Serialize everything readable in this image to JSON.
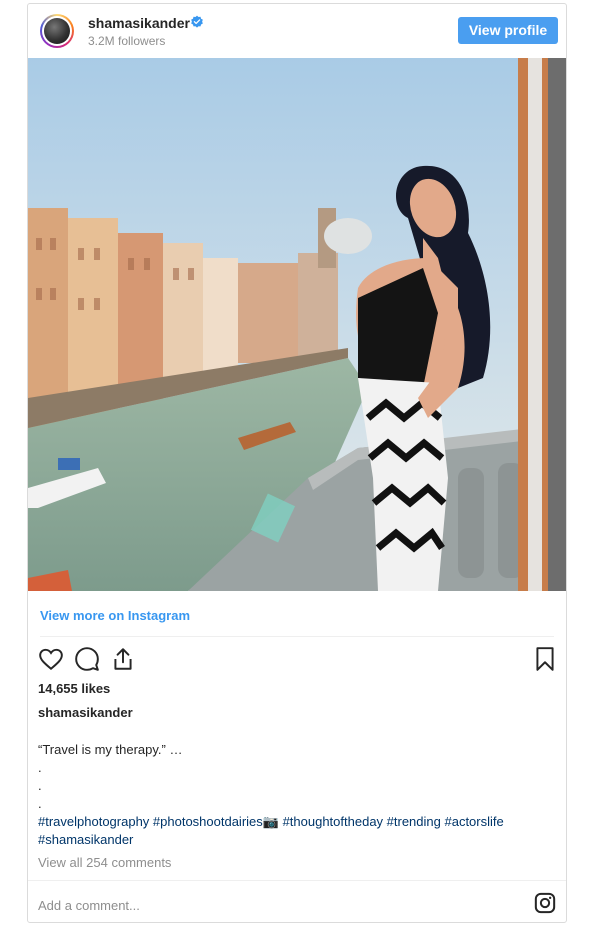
{
  "header": {
    "username": "shamasikander",
    "followers": "3.2M followers",
    "view_profile_label": "View profile"
  },
  "links": {
    "view_more": "View more on Instagram"
  },
  "post": {
    "likes": "14,655 likes",
    "caption_user": "shamasikander",
    "caption": "“Travel is my therapy.” …\n.\n.\n.",
    "hashtags_line1": "#travelphotography #photoshootdairies📷 #thoughtoftheday #trending #actorslife",
    "hashtags_line2": "#shamasikander",
    "view_comments": "View all 254 comments",
    "add_comment_placeholder": "Add a comment..."
  },
  "colors": {
    "accent": "#3897f0",
    "button": "#4a9ef0",
    "hashtag": "#003569",
    "muted": "#8e8e8e"
  }
}
